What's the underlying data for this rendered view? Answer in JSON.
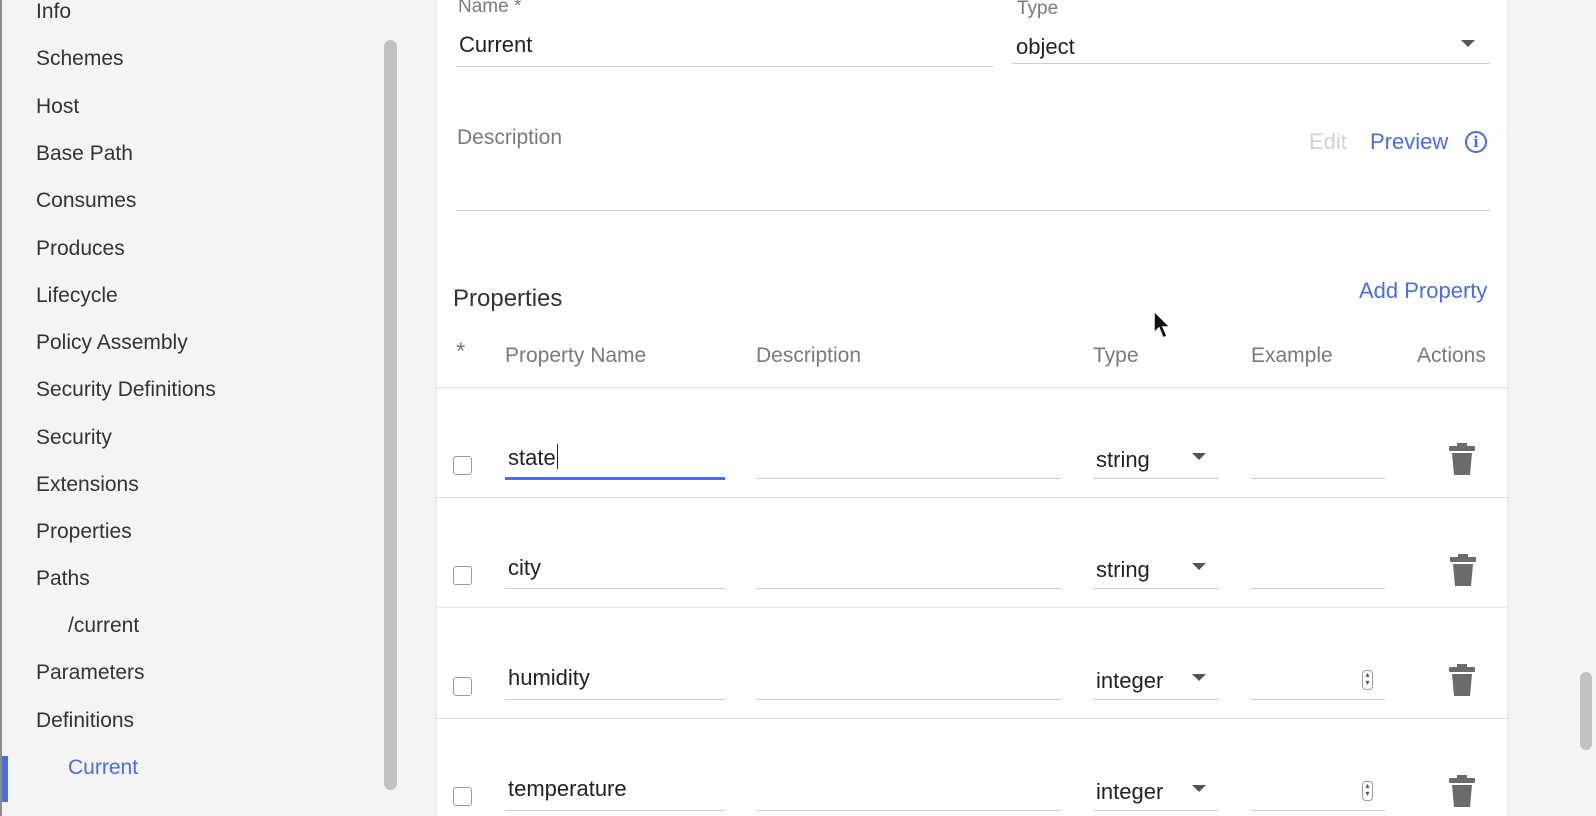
{
  "sidebar": {
    "items": [
      {
        "label": "Info"
      },
      {
        "label": "Schemes"
      },
      {
        "label": "Host"
      },
      {
        "label": "Base Path"
      },
      {
        "label": "Consumes"
      },
      {
        "label": "Produces"
      },
      {
        "label": "Lifecycle"
      },
      {
        "label": "Policy Assembly"
      },
      {
        "label": "Security Definitions"
      },
      {
        "label": "Security"
      },
      {
        "label": "Extensions"
      },
      {
        "label": "Properties"
      },
      {
        "label": "Paths"
      },
      {
        "label": "/current"
      },
      {
        "label": "Parameters"
      },
      {
        "label": "Definitions"
      },
      {
        "label": "Current"
      }
    ],
    "active_item": "Current"
  },
  "form": {
    "name_label": "Name *",
    "name_value": "Current",
    "type_label": "Type",
    "type_value": "object",
    "description_label": "Description",
    "edit_label": "Edit",
    "preview_label": "Preview"
  },
  "properties": {
    "title": "Properties",
    "add_label": "Add Property",
    "columns": {
      "required": "*",
      "name": "Property Name",
      "description": "Description",
      "type": "Type",
      "example": "Example",
      "actions": "Actions"
    },
    "rows": [
      {
        "name": "state",
        "description": "",
        "type": "string",
        "example": ""
      },
      {
        "name": "city",
        "description": "",
        "type": "string",
        "example": ""
      },
      {
        "name": "humidity",
        "description": "",
        "type": "integer",
        "example": ""
      },
      {
        "name": "temperature",
        "description": "",
        "type": "integer",
        "example": ""
      }
    ]
  },
  "colors": {
    "accent": "#4a6ee0",
    "text": "#222222",
    "muted": "#7a7a7a"
  }
}
